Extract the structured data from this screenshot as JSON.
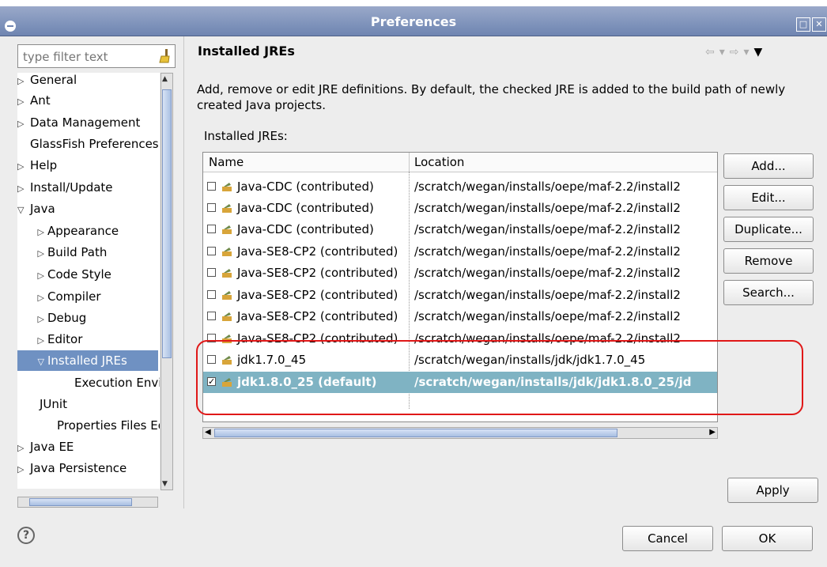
{
  "window": {
    "title": "Preferences"
  },
  "filter": {
    "placeholder": "type filter text"
  },
  "tree": {
    "items": [
      {
        "label": "General",
        "twisty": "▷"
      },
      {
        "label": "Ant",
        "twisty": "▷"
      },
      {
        "label": "Data Management",
        "twisty": "▷"
      },
      {
        "label": "GlassFish Preferences",
        "twisty": ""
      },
      {
        "label": "Help",
        "twisty": "▷"
      },
      {
        "label": "Install/Update",
        "twisty": "▷"
      },
      {
        "label": "Java",
        "twisty": "▽"
      },
      {
        "label": "Appearance",
        "twisty": "▷"
      },
      {
        "label": "Build Path",
        "twisty": "▷"
      },
      {
        "label": "Code Style",
        "twisty": "▷"
      },
      {
        "label": "Compiler",
        "twisty": "▷"
      },
      {
        "label": "Debug",
        "twisty": "▷"
      },
      {
        "label": "Editor",
        "twisty": "▷"
      },
      {
        "label": "Installed JREs",
        "twisty": "▽"
      },
      {
        "label": "Execution Environments",
        "twisty": ""
      },
      {
        "label": "JUnit",
        "twisty": ""
      },
      {
        "label": "Properties Files Editor",
        "twisty": ""
      },
      {
        "label": "Java EE",
        "twisty": "▷"
      },
      {
        "label": "Java Persistence",
        "twisty": "▷"
      }
    ]
  },
  "page": {
    "title": "Installed JREs",
    "description": "Add, remove or edit JRE definitions. By default, the checked JRE is added to the build path of newly created Java projects.",
    "list_label": "Installed JREs:"
  },
  "table": {
    "columns": [
      "Name",
      "Location"
    ],
    "rows": [
      {
        "name": "Java-CDC (contributed)",
        "location": "/scratch/wegan/installs/oepe/maf-2.2/install2",
        "checked": ""
      },
      {
        "name": "Java-CDC (contributed)",
        "location": "/scratch/wegan/installs/oepe/maf-2.2/install2",
        "checked": ""
      },
      {
        "name": "Java-CDC (contributed)",
        "location": "/scratch/wegan/installs/oepe/maf-2.2/install2",
        "checked": ""
      },
      {
        "name": "Java-SE8-CP2 (contributed)",
        "location": "/scratch/wegan/installs/oepe/maf-2.2/install2",
        "checked": ""
      },
      {
        "name": "Java-SE8-CP2 (contributed)",
        "location": "/scratch/wegan/installs/oepe/maf-2.2/install2",
        "checked": ""
      },
      {
        "name": "Java-SE8-CP2 (contributed)",
        "location": "/scratch/wegan/installs/oepe/maf-2.2/install2",
        "checked": ""
      },
      {
        "name": "Java-SE8-CP2 (contributed)",
        "location": "/scratch/wegan/installs/oepe/maf-2.2/install2",
        "checked": ""
      },
      {
        "name": "Java-SE8-CP2 (contributed)",
        "location": "/scratch/wegan/installs/oepe/maf-2.2/install2",
        "checked": ""
      },
      {
        "name": "jdk1.7.0_45",
        "location": "/scratch/wegan/installs/jdk/jdk1.7.0_45",
        "checked": ""
      },
      {
        "name": "jdk1.8.0_25 (default)",
        "location": "/scratch/wegan/installs/jdk/jdk1.8.0_25/jd",
        "checked": "✓"
      }
    ]
  },
  "buttons": {
    "add": "Add...",
    "edit": "Edit...",
    "duplicate": "Duplicate...",
    "remove": "Remove",
    "search": "Search...",
    "apply": "Apply",
    "cancel": "Cancel",
    "ok": "OK"
  },
  "help": {
    "glyph": "?"
  },
  "colors": {
    "titlebar": "#7f93bb",
    "selection": "#6f91c2",
    "row_selected": "#7fb3c3",
    "highlight": "#e01818"
  }
}
